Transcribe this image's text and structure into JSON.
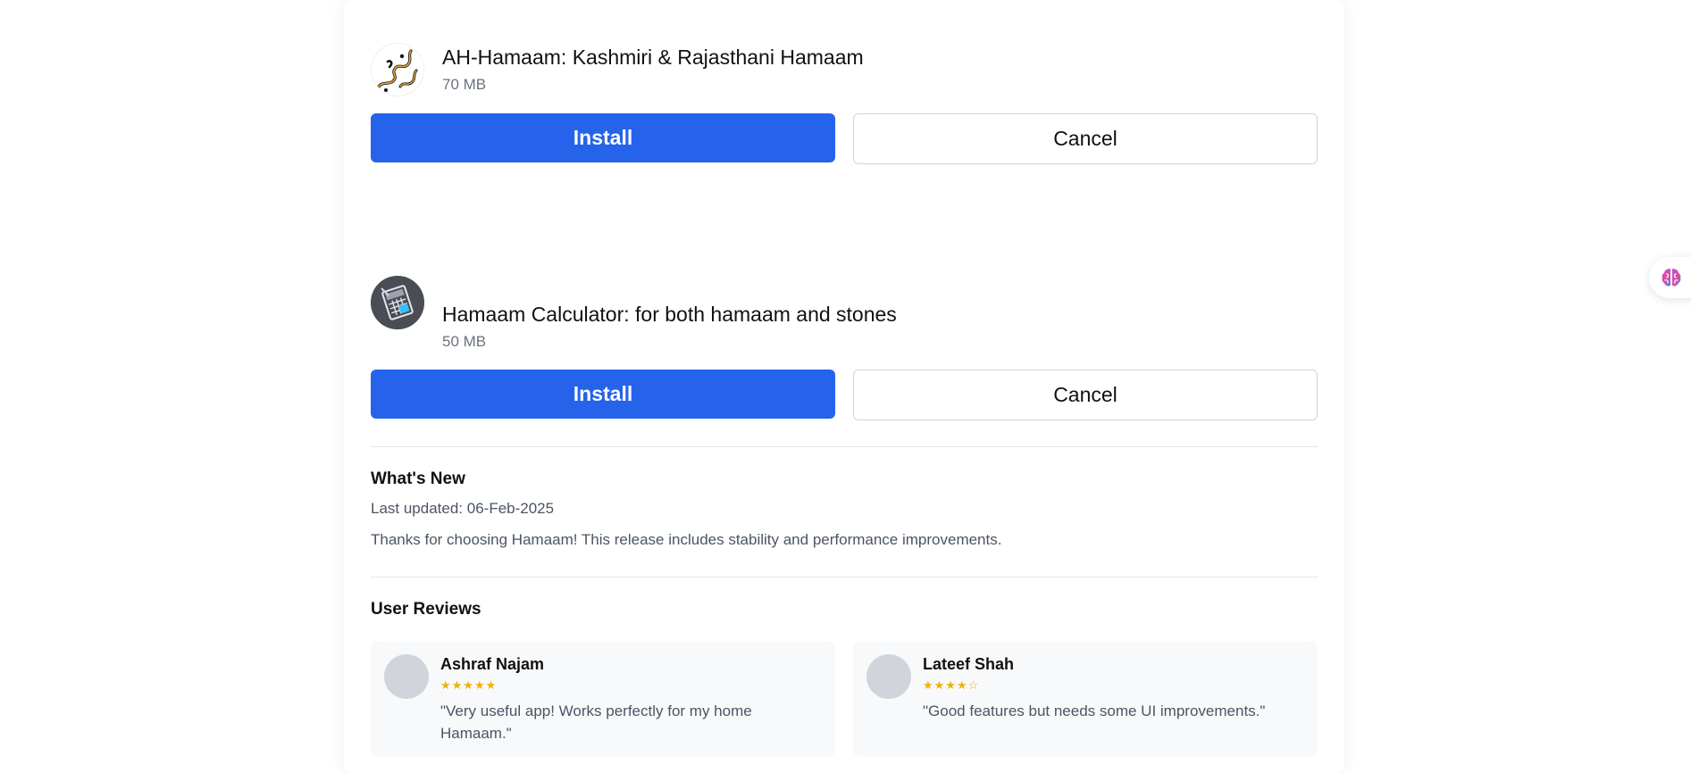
{
  "apps": [
    {
      "title": "AH-Hamaam: Kashmiri & Rajasthani Hamaam",
      "size": "70 MB",
      "install_label": "Install",
      "cancel_label": "Cancel",
      "icon": "calligraphy-logo-icon"
    },
    {
      "title": "Hamaam Calculator: for both hamaam and stones",
      "size": "50 MB",
      "install_label": "Install",
      "cancel_label": "Cancel",
      "icon": "calculator-logo-icon"
    }
  ],
  "whats_new": {
    "title": "What's New",
    "last_updated": "Last updated: 06-Feb-2025",
    "notes": "Thanks for choosing Hamaam! This release includes stability and performance improvements."
  },
  "reviews": {
    "title": "User Reviews",
    "items": [
      {
        "name": "Ashraf Najam",
        "stars": "★★★★★",
        "rating": 5,
        "text": "\"Very useful app! Works perfectly for my home Hamaam.\""
      },
      {
        "name": "Lateef Shah",
        "stars": "★★★★☆",
        "rating": 4,
        "text": "\"Good features but needs some UI improvements.\""
      }
    ]
  },
  "floating_assistant": {
    "icon": "brain-icon"
  },
  "colors": {
    "primary": "#2563eb",
    "star": "#eab308",
    "muted_text": "#6b7280",
    "review_bg": "#f8f9fb"
  }
}
